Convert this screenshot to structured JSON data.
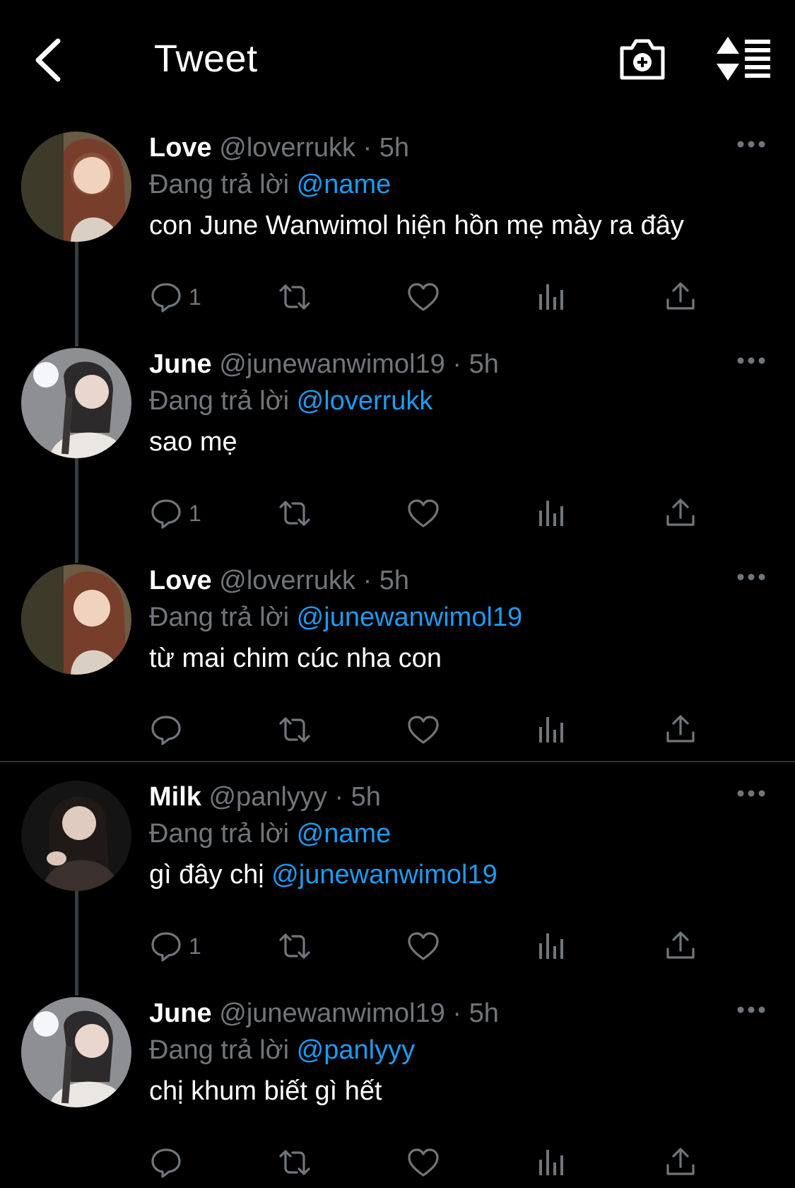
{
  "header": {
    "title": "Tweet",
    "back_icon": "back-chevron-icon",
    "camera_icon": "camera-plus-icon",
    "sort_icon": "sort-icon"
  },
  "colors": {
    "background": "#000000",
    "link": "#1d9bf0",
    "muted": "#71767b",
    "text": "#ffffff"
  },
  "tweets": [
    {
      "name": "Love",
      "handle": "@loverrukk",
      "dot": "·",
      "time": "5h",
      "reply_prefix": "Đang trả lời",
      "reply_to": "@name",
      "text": "con June Wanwimol hiện hồn mẹ mày ra đây",
      "text_mention": "",
      "reply_count": "1",
      "avatar": "avatar-love"
    },
    {
      "name": "June",
      "handle": "@junewanwimol19",
      "dot": "·",
      "time": "5h",
      "reply_prefix": "Đang trả lời",
      "reply_to": "@loverrukk",
      "text": "sao mẹ",
      "text_mention": "",
      "reply_count": "1",
      "avatar": "avatar-june"
    },
    {
      "name": "Love",
      "handle": "@loverrukk",
      "dot": "·",
      "time": "5h",
      "reply_prefix": "Đang trả lời",
      "reply_to": "@junewanwimol19",
      "text": "từ mai chim cúc nha con",
      "text_mention": "",
      "reply_count": "",
      "avatar": "avatar-love"
    },
    {
      "name": "Milk",
      "handle": "@panlyyy",
      "dot": "·",
      "time": "5h",
      "reply_prefix": "Đang trả lời",
      "reply_to": "@name",
      "text": "gì đây chị ",
      "text_mention": "@junewanwimol19",
      "reply_count": "1",
      "avatar": "avatar-milk"
    },
    {
      "name": "June",
      "handle": "@junewanwimol19",
      "dot": "·",
      "time": "5h",
      "reply_prefix": "Đang trả lời",
      "reply_to": "@panlyyy",
      "text": "chị khum biết gì hết",
      "text_mention": "",
      "reply_count": "",
      "avatar": "avatar-june"
    }
  ]
}
